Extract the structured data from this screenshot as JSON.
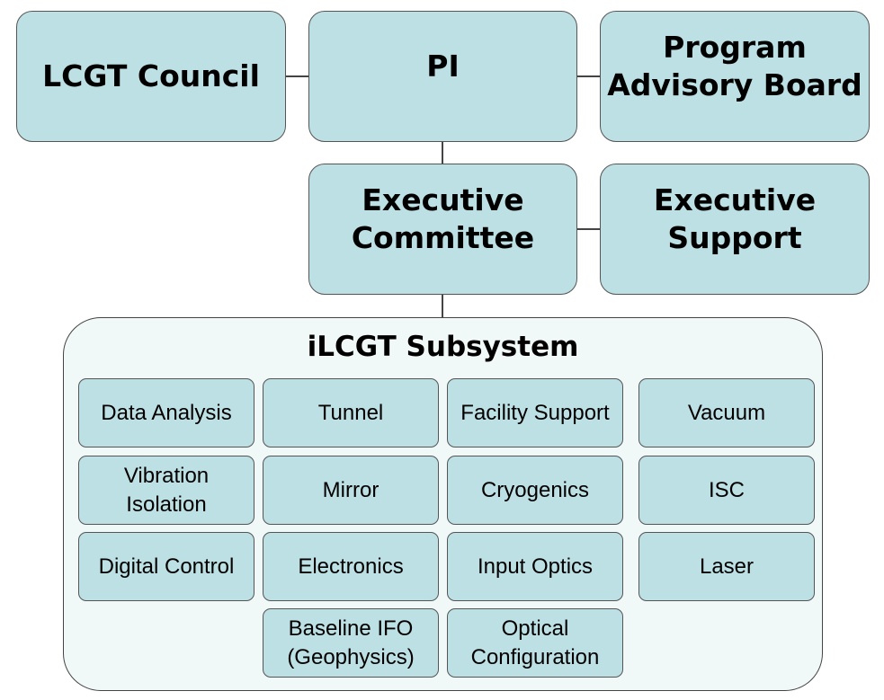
{
  "top_boxes": {
    "council": "LCGT Council",
    "pi": "PI",
    "advisory_line1": "Program",
    "advisory_line2": "Advisory Board",
    "exec_committee_line1": "Executive",
    "exec_committee_line2": "Committee",
    "exec_support_line1": "Executive",
    "exec_support_line2": "Support"
  },
  "subsystem": {
    "title": "iLCGT Subsystem",
    "cells": [
      {
        "l1": "Data Analysis"
      },
      {
        "l1": "Tunnel"
      },
      {
        "l1": "Facility Support"
      },
      {
        "l1": "Vacuum"
      },
      {
        "l1": "Vibration",
        "l2": "Isolation"
      },
      {
        "l1": "Mirror"
      },
      {
        "l1": "Cryogenics"
      },
      {
        "l1": "ISC"
      },
      {
        "l1": "Digital Control"
      },
      {
        "l1": "Electronics"
      },
      {
        "l1": "Input Optics"
      },
      {
        "l1": "Laser"
      },
      {
        "l1": "Baseline IFO",
        "l2": "(Geophysics)"
      },
      {
        "l1": "Optical",
        "l2": "Configuration"
      }
    ]
  },
  "colors": {
    "box_fill": "#bde0e4",
    "container_fill": "#f1f8f8",
    "border": "#555555"
  }
}
